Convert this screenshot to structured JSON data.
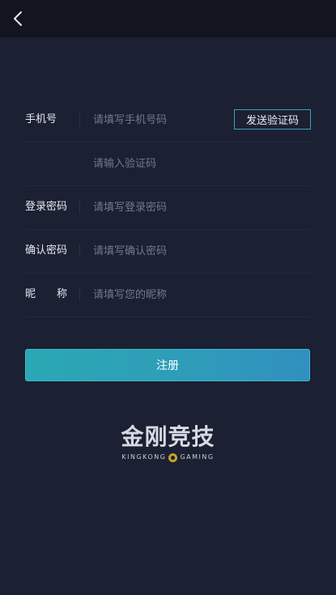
{
  "header": {
    "back_icon": "chevron-left-icon"
  },
  "form": {
    "phone": {
      "label": "手机号",
      "placeholder": "请填写手机号码",
      "send_code_label": "发送验证码"
    },
    "code": {
      "placeholder": "请输入验证码"
    },
    "login_password": {
      "label": "登录密码",
      "placeholder": "请填写登录密码"
    },
    "confirm_password": {
      "label": "确认密码",
      "placeholder": "请填写确认密码"
    },
    "nickname": {
      "label_chars": [
        "昵",
        "称"
      ],
      "placeholder": "请填写您的昵称"
    }
  },
  "submit_label": "注册",
  "brand": {
    "title": "金刚竞技",
    "sub_left": "KINGKONG",
    "sub_right": "GAMING"
  },
  "colors": {
    "background": "#1b2032",
    "top_bar": "#12151f",
    "accent_border": "#3ba0c4",
    "button_gradient_start": "#2aa8b3",
    "button_gradient_end": "#3190bf"
  }
}
